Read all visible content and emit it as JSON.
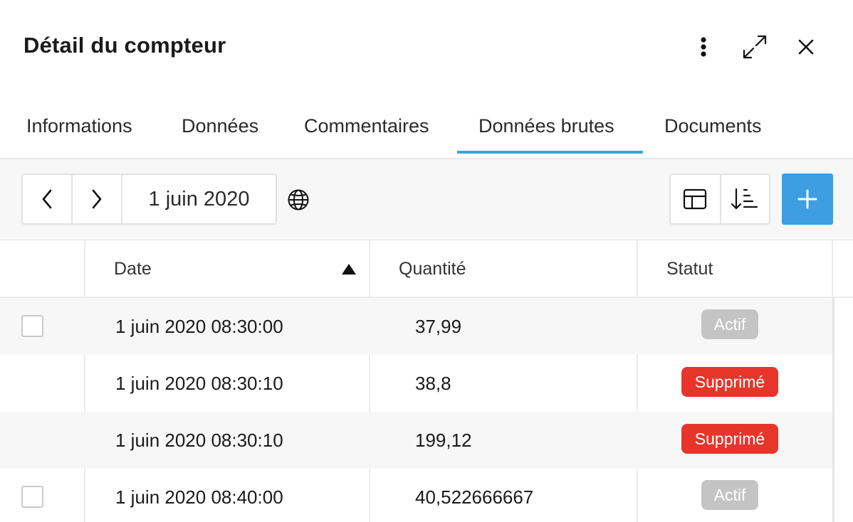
{
  "header": {
    "title": "Détail du compteur",
    "more_icon": "kebab-vertical-icon",
    "expand_icon": "expand-arrows-icon",
    "close_icon": "close-icon"
  },
  "tabs": [
    {
      "label": "Informations",
      "active": false
    },
    {
      "label": "Données",
      "active": false
    },
    {
      "label": "Commentaires",
      "active": false
    },
    {
      "label": "Données brutes",
      "active": true
    },
    {
      "label": "Documents",
      "active": false
    }
  ],
  "toolbar": {
    "prev_icon": "chevron-left-icon",
    "next_icon": "chevron-right-icon",
    "date": "1 juin 2020",
    "timezone_icon": "globe-icon",
    "columns_icon": "table-layout-icon",
    "sort_icon": "sort-descending-icon",
    "add_icon": "plus-icon"
  },
  "table": {
    "columns": [
      "Date",
      "Quantité",
      "Statut"
    ],
    "sort": {
      "column": "Date",
      "direction": "ascending"
    },
    "rows": [
      {
        "date": "1 juin 2020 08:30:00",
        "quantite": "37,99",
        "statut": "Actif",
        "has_checkbox": true
      },
      {
        "date": "1 juin 2020 08:30:10",
        "quantite": "38,8",
        "statut": "Supprimé",
        "has_checkbox": false
      },
      {
        "date": "1 juin 2020 08:30:10",
        "quantite": "199,12",
        "statut": "Supprimé",
        "has_checkbox": false
      },
      {
        "date": "1 juin 2020 08:40:00",
        "quantite": "40,522666667",
        "statut": "Actif",
        "has_checkbox": true
      }
    ]
  },
  "colors": {
    "accent": "#3d9fe2",
    "status_active": "#c4c4c4",
    "status_deleted": "#e8352b"
  }
}
